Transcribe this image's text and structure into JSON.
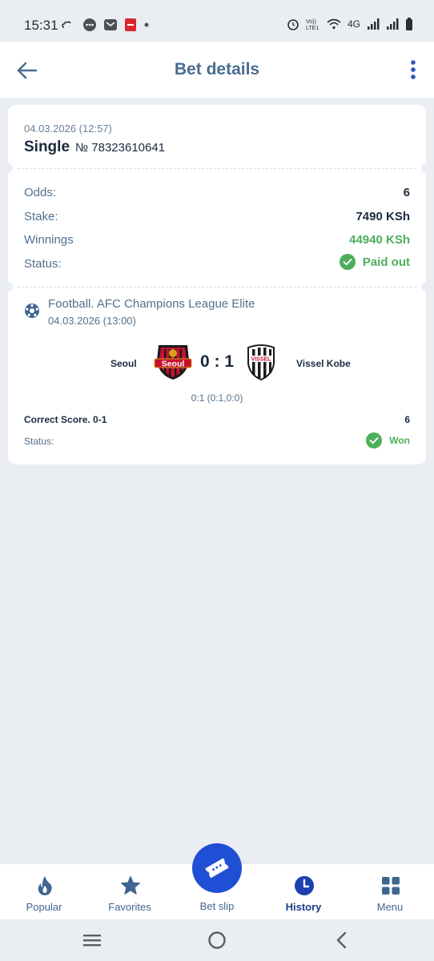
{
  "status_bar": {
    "time": "15:31",
    "network": "4G",
    "volte": "Vo))\nLTE1",
    "left_icons": [
      "weather-icon",
      "messages-icon",
      "mail-icon",
      "app-notification-icon",
      "dot-icon"
    ],
    "right_icons": [
      "alarm-icon",
      "volte-icon",
      "wifi-icon",
      "signal-icon",
      "signal-icon",
      "battery-icon"
    ]
  },
  "header": {
    "title": "Bet details",
    "back_icon": "arrow-left-icon",
    "menu_icon": "more-vertical-icon"
  },
  "bet": {
    "date": "04.03.2026 (12:57)",
    "type": "Single",
    "number": "№ 78323610641",
    "rows": {
      "odds": {
        "label": "Odds:",
        "value": "6"
      },
      "stake": {
        "label": "Stake:",
        "value": "7490 KSh"
      },
      "winnings": {
        "label": "Winnings",
        "value": "44940 KSh"
      },
      "status": {
        "label": "Status:",
        "value": "Paid out"
      }
    }
  },
  "event": {
    "sport_icon": "football-icon",
    "league": "Football. AFC Champions League Elite",
    "date": "04.03.2026 (13:00)",
    "home_team": "Seoul",
    "home_logo_text": "Seoul",
    "away_team": "Vissel Kobe",
    "away_logo_text": "VISSEL",
    "score": "0 : 1",
    "period_score": "0:1 (0:1,0:0)"
  },
  "selection": {
    "market": "Correct Score. 0-1",
    "odds": "6",
    "status_label": "Status:",
    "status_value": "Won"
  },
  "bottom_nav": {
    "items": [
      {
        "label": "Popular",
        "icon": "flame-icon"
      },
      {
        "label": "Favorites",
        "icon": "star-icon"
      },
      {
        "label": "Bet slip",
        "icon": "ticket-icon"
      },
      {
        "label": "History",
        "icon": "clock-icon",
        "active": true
      },
      {
        "label": "Menu",
        "icon": "grid-icon"
      }
    ]
  },
  "colors": {
    "background": "#eaedf2",
    "title": "#4a6c8e",
    "accent": "#1f4fd4",
    "success": "#4caf59",
    "text_dark": "#1b2a3e"
  }
}
